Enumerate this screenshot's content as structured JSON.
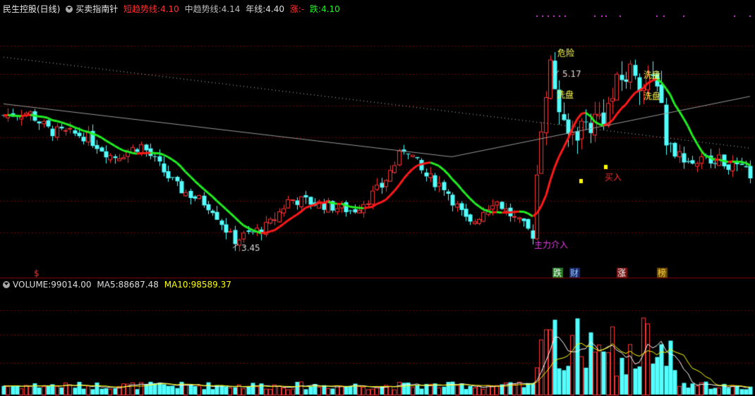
{
  "header": {
    "stock_title": "民生控股(日线)",
    "indicator_name": "买卖指南针",
    "short_label": "短趋势线:",
    "short_value": "4.10",
    "mid_label": "中趋势线:",
    "mid_value": "4.14",
    "year_label": "年线:",
    "year_value": "4.40",
    "up_label": "涨:",
    "up_value": "-",
    "down_label": "跌:",
    "down_value": "4.10"
  },
  "volume_header": {
    "volume_label": "VOLUME:",
    "volume_value": "99014.00",
    "ma5_label": "MA5:",
    "ma5_value": "88687.48",
    "ma10_label": "MA10:",
    "ma10_value": "98589.37"
  },
  "colors": {
    "up": "#ff3232",
    "down": "#54ffff",
    "trend_up": "#ff1a1a",
    "trend_down": "#22ee22",
    "year_line": "#9a9a9a",
    "ma5": "#ffffff",
    "ma10": "#ffff00",
    "grid": "#7a0000"
  },
  "chart_data": {
    "type": "candlestick",
    "price_range": [
      3.3,
      5.5
    ],
    "volume_max": 120000,
    "annotations": {
      "high_label": "5.17",
      "low_label": "3.45",
      "danger": "危险",
      "wash1": "洗盘",
      "wash2": "洗盘",
      "wash3": "洗盘",
      "buy": "买入",
      "main_force": "主力介入",
      "badge_die": "跌",
      "badge_cai": "财",
      "badge_zhang": "涨",
      "badge_bang": "榜"
    }
  }
}
